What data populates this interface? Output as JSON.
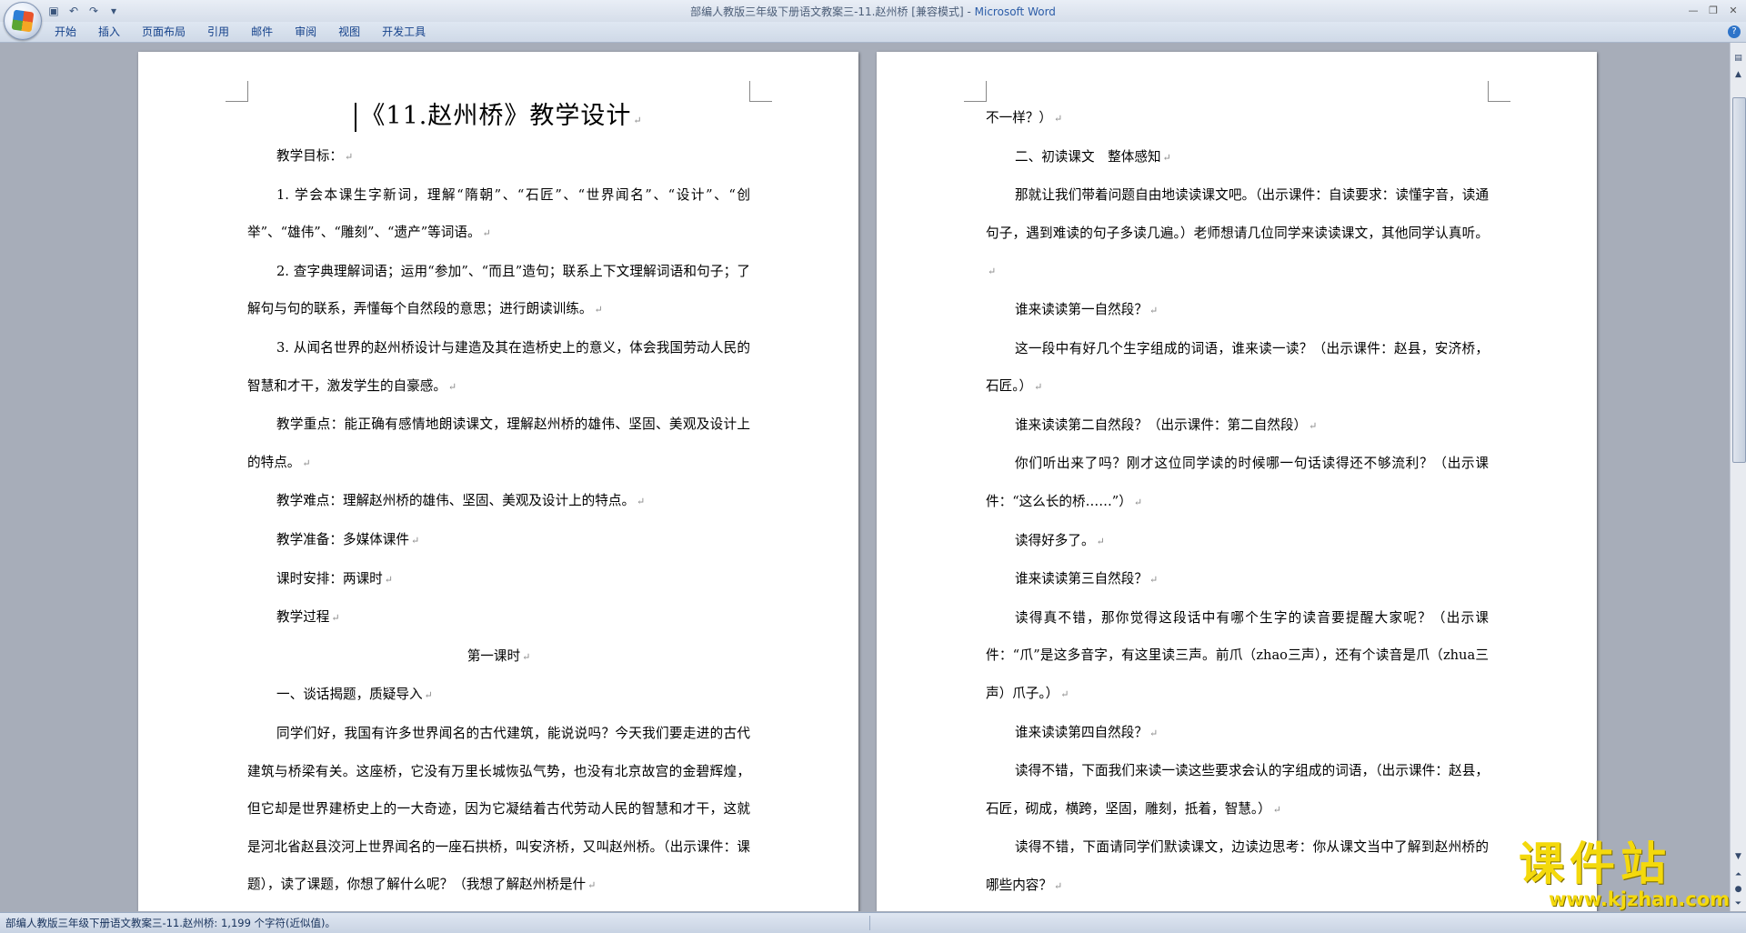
{
  "window": {
    "doc_name": "部编人教版三年级下册语文教案三-11.赵州桥 [兼容模式]",
    "separator": " - ",
    "app_name": "Microsoft Word"
  },
  "quick_access": [
    "save-icon",
    "undo-icon",
    "redo-icon",
    "customize-icon"
  ],
  "ribbon": {
    "tabs": [
      "开始",
      "插入",
      "页面布局",
      "引用",
      "邮件",
      "审阅",
      "视图",
      "开发工具"
    ]
  },
  "document": {
    "page1": {
      "title": "《11.赵州桥》教学设计",
      "paragraphs": [
        "教学目标：",
        "1. 学会本课生字新词，理解“隋朝”、“石匠”、“世界闻名”、“设计”、“创举”、“雄伟”、“雕刻”、“遗产”等词语。",
        "2. 查字典理解词语；运用“参加”、“而且”造句；联系上下文理解词语和句子；了解句与句的联系，弄懂每个自然段的意思；进行朗读训练。",
        "3. 从闻名世界的赵州桥设计与建造及其在造桥史上的意义，体会我国劳动人民的智慧和才干，激发学生的自豪感。",
        "教学重点：能正确有感情地朗读课文，理解赵州桥的雄伟、坚固、美观及设计上的特点。",
        "教学难点：理解赵州桥的雄伟、坚固、美观及设计上的特点。",
        "教学准备：多媒体课件",
        "课时安排：两课时",
        "教学过程",
        "第一课时",
        "一、谈话揭题，质疑导入",
        "同学们好，我国有许多世界闻名的古代建筑，能说说吗？今天我们要走进的古代建筑与桥梁有关。这座桥，它没有万里长城恢弘气势，也没有北京故宫的金碧辉煌，但它却是世界建桥史上的一大奇迹，因为它凝结着古代劳动人民的智慧和才干，这就是河北省赵县洨河上世界闻名的一座石拱桥，叫安济桥，又叫赵州桥。（出示课件：课题），读了课题，你想了解什么呢？（我想了解赵州桥是什"
      ]
    },
    "page2": {
      "paragraphs": [
        "不一样？）",
        "二、初读课文　整体感知",
        "那就让我们带着问题自由地读读课文吧。（出示课件：自读要求：读懂字音，读通句子，遇到难读的句子多读几遍。）老师想请几位同学来读读课文，其他同学认真听。",
        "谁来读读第一自然段？",
        "这一段中有好几个生字组成的词语，谁来读一读？（出示课件：赵县，安济桥，石匠。）",
        "谁来读读第二自然段？（出示课件：第二自然段）",
        "你们听出来了吗？刚才这位同学读的时候哪一句话读得还不够流利？（出示课件：“这么长的桥……”）",
        "读得好多了。",
        "谁来读读第三自然段？",
        "读得真不错，那你觉得这段话中有哪个生字的读音要提醒大家呢？（出示课件：“爪”是这多音字，有这里读三声。前爪（zhao三声），还有个读音是爪（zhua三声）爪子。）",
        "谁来读读第四自然段？",
        "读得不错，下面我们来读一读这些要求会认的字组成的词语，（出示课件：赵县，石匠，砌成，横跨，坚固，雕刻，抵着，智慧。）",
        "读得不错，下面请同学们默读课文，边读边思考：你从课文当中了解到赵州桥的哪些内容？"
      ]
    },
    "paragraph_mark": "↵"
  },
  "status_bar": {
    "text": "部编人教版三年级下册语文教案三-11.赵州桥: 1,199 个字符(近似值)。"
  },
  "watermark": {
    "main": "课件站",
    "url": "www.kjzhan.com"
  }
}
